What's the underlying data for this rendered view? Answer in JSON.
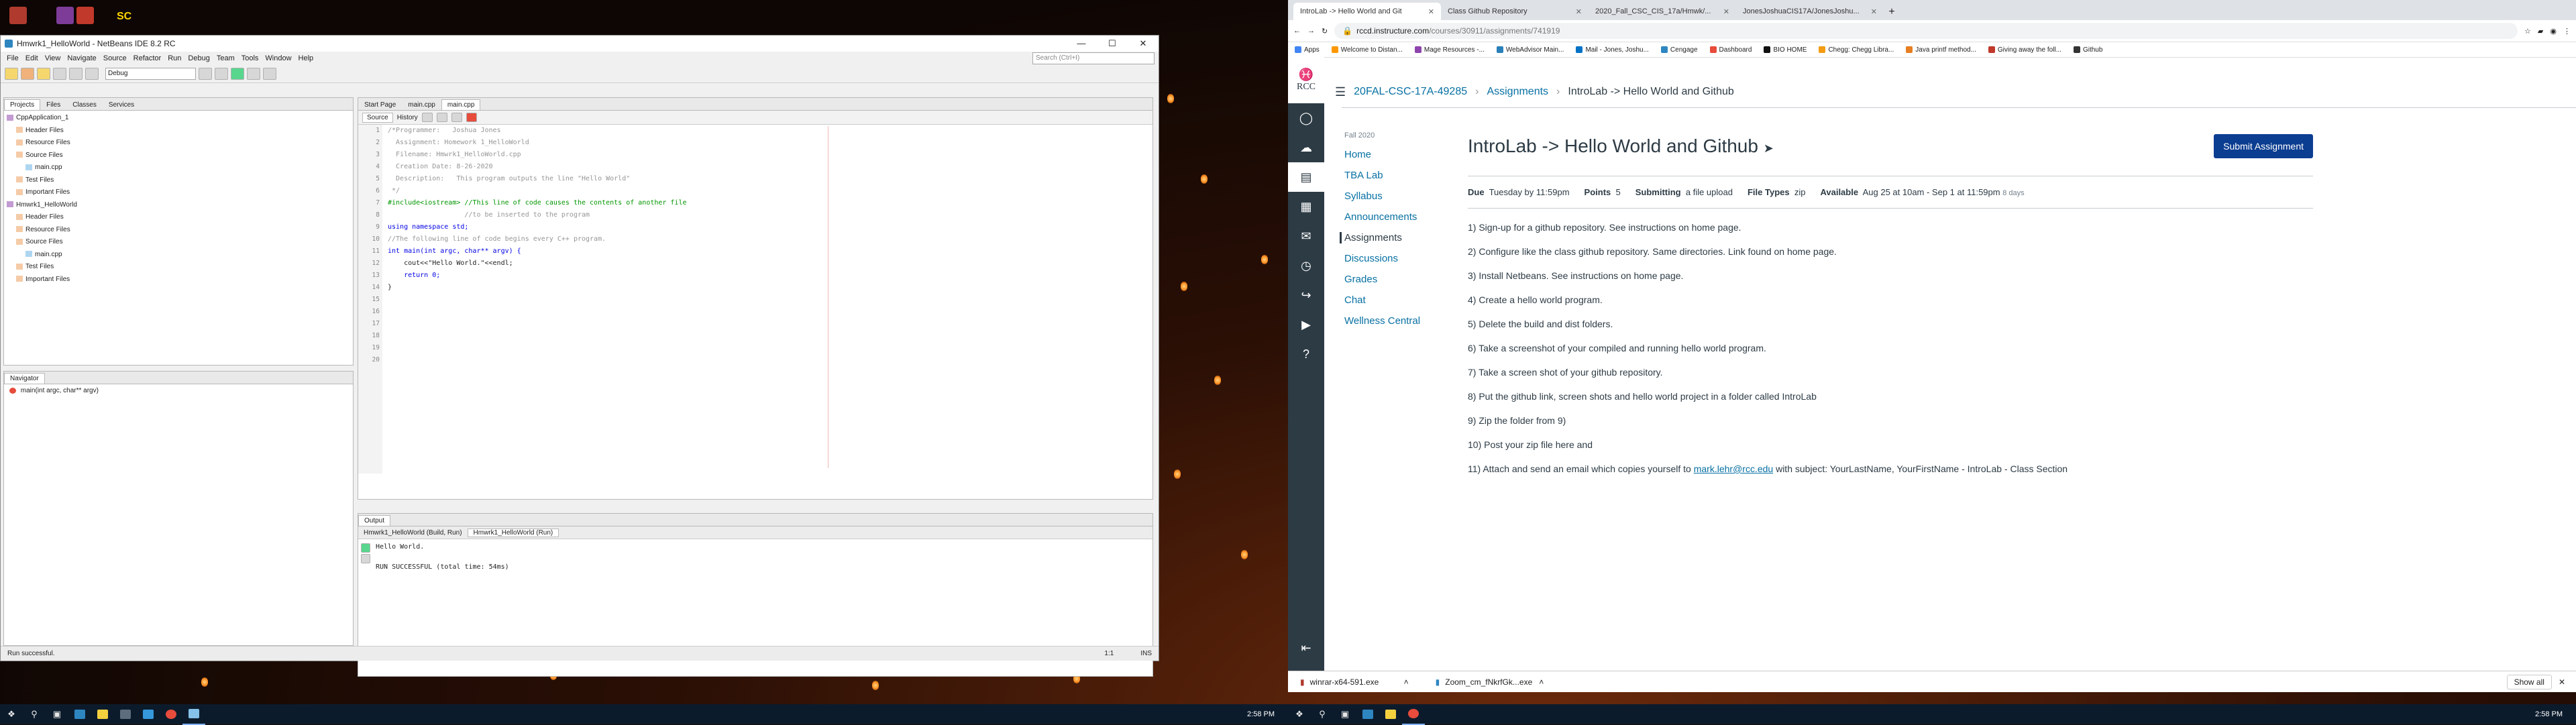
{
  "desktop": {
    "icon_label": "SC"
  },
  "netbeans": {
    "title": "Hmwrk1_HelloWorld - NetBeans IDE 8.2 RC",
    "menu": [
      "File",
      "Edit",
      "View",
      "Navigate",
      "Source",
      "Refactor",
      "Run",
      "Debug",
      "Team",
      "Tools",
      "Window",
      "Help"
    ],
    "config": "Debug",
    "search_placeholder": "Search (Ctrl+I)",
    "project_tabs": [
      "Projects",
      "Files",
      "Classes",
      "Services"
    ],
    "tree": [
      {
        "label": "CppApplication_1",
        "level": 0
      },
      {
        "label": "Header Files",
        "level": 1
      },
      {
        "label": "Resource Files",
        "level": 1
      },
      {
        "label": "Source Files",
        "level": 1
      },
      {
        "label": "main.cpp",
        "level": 2
      },
      {
        "label": "Test Files",
        "level": 1
      },
      {
        "label": "Important Files",
        "level": 1
      },
      {
        "label": "Hmwrk1_HelloWorld",
        "level": 0
      },
      {
        "label": "Header Files",
        "level": 1
      },
      {
        "label": "Resource Files",
        "level": 1
      },
      {
        "label": "Source Files",
        "level": 1
      },
      {
        "label": "main.cpp",
        "level": 2
      },
      {
        "label": "Test Files",
        "level": 1
      },
      {
        "label": "Important Files",
        "level": 1
      }
    ],
    "navigator_title": "Navigator",
    "navigator_item": "main(int argc, char** argv)",
    "editor_tabs": [
      "Start Page",
      "main.cpp",
      "main.cpp"
    ],
    "source_tabs": [
      "Source",
      "History"
    ],
    "code_lines": [
      "/*Programmer:   Joshua Jones",
      "  Assignment: Homework 1_HelloWorld",
      "  Filename: Hmwrk1_HelloWorld.cpp",
      "  Creation Date: 8-26-2020",
      "  Description:   This program outputs the line \"Hello World\"",
      " */",
      "",
      "#include<iostream> //This line of code causes the contents of another file",
      "                   //to be inserted to the program",
      "",
      "using namespace std;",
      "",
      "//The following line of code begins every C++ program.",
      "int main(int argc, char** argv) {",
      "    cout<<\"Hello World.\"<<endl;",
      "",
      "    return 0;",
      "}",
      "",
      ""
    ],
    "output_title": "Output",
    "output_tabs": [
      "Hmwrk1_HelloWorld (Build, Run)",
      "Hmwrk1_HelloWorld (Run)"
    ],
    "output_lines": [
      "Hello World.",
      "",
      "RUN SUCCESSFUL (total time: 54ms)"
    ],
    "status_text": "Run successful.",
    "caret_pos": "1:1",
    "ins": "INS"
  },
  "chrome": {
    "tabs": [
      "IntroLab -> Hello World and Git",
      "Class Github Repository",
      "2020_Fall_CSC_CIS_17a/Hmwk/...",
      "JonesJoshuaCIS17A/JonesJoshu..."
    ],
    "url_host": "rccd.instructure.com",
    "url_path": "/courses/30911/assignments/741919",
    "bookmarks": [
      "Apps",
      "Welcome to Distan...",
      "Mage Resources -...",
      "WebAdvisor Main...",
      "Mail - Jones, Joshu...",
      "Cengage",
      "Dashboard",
      "BIO HOME",
      "Chegg: Chegg Libra...",
      "Java printf method...",
      "Giving away the foll...",
      "Github"
    ],
    "breadcrumb": [
      "20FAL-CSC-17A-49285",
      "Assignments",
      "IntroLab -> Hello World and Github"
    ],
    "term": "Fall 2020",
    "course_nav": [
      "Home",
      "TBA Lab",
      "Syllabus",
      "Announcements",
      "Assignments",
      "Discussions",
      "Grades",
      "Chat",
      "Wellness Central"
    ],
    "active_nav": "Assignments",
    "logo_text": "RCC",
    "assignment": {
      "title": "IntroLab -> Hello World and Github",
      "submit_label": "Submit Assignment",
      "due_label": "Due",
      "due": "Tuesday by 11:59pm",
      "points_label": "Points",
      "points": "5",
      "submitting_label": "Submitting",
      "submitting": "a file upload",
      "file_types_label": "File Types",
      "file_types": "zip",
      "available_label": "Available",
      "available": "Aug 25 at 10am - Sep 1 at 11:59pm",
      "available_days": "8 days",
      "steps": [
        "1)  Sign-up for a github repository.  See instructions on home page.",
        "2)  Configure like the class github repository.  Same directories.  Link found on home page.",
        "3)  Install Netbeans.  See instructions on home page.",
        "4)  Create a hello world program.",
        "5)  Delete the build and dist folders.",
        "6)  Take a screenshot of your compiled and running hello world program.",
        "7)  Take a screen shot of your github repository.",
        "8)  Put the github link, screen shots and hello world project in a folder called IntroLab",
        "9)  Zip the folder from 9)",
        "10)  Post your zip file here and"
      ],
      "step11_prefix": "11)  Attach and send an email which copies yourself to ",
      "email": "mark.lehr@rcc.edu",
      "step11_suffix": " with subject:  YourLastName, YourFirstName - IntroLab - Class Section"
    },
    "downloads": [
      "winrar-x64-591.exe",
      "Zoom_cm_fNkrfGk...exe"
    ],
    "show_all": "Show all"
  },
  "taskbar_left": {
    "time": "2:58 PM"
  },
  "taskbar_right": {
    "time": "2:58 PM"
  }
}
